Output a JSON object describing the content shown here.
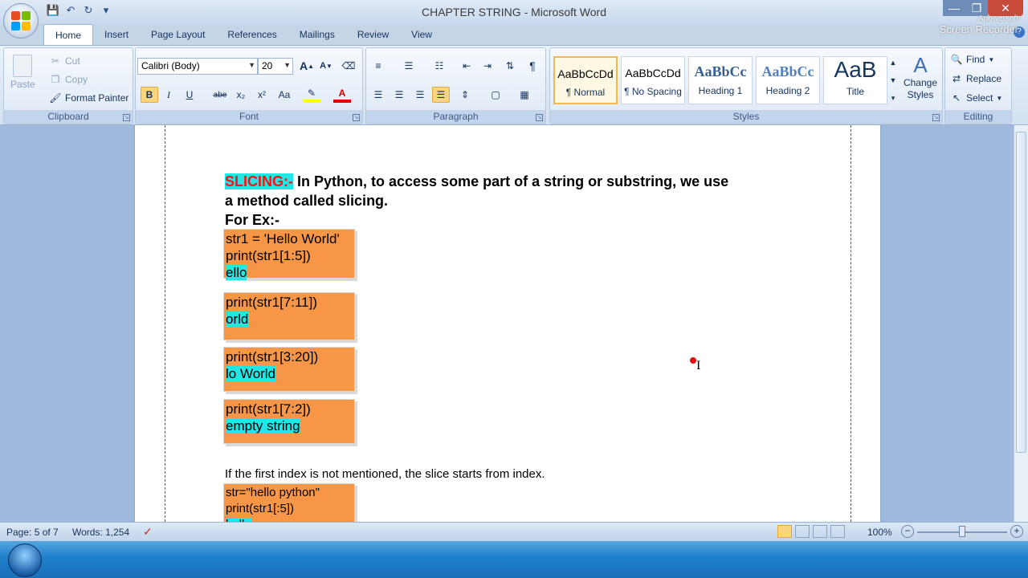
{
  "window": {
    "title": "CHAPTER STRING - Microsoft Word"
  },
  "quick_access": [
    "save-icon",
    "undo-icon",
    "redo-icon",
    "customize-icon"
  ],
  "tabs": [
    {
      "label": "Home",
      "active": true
    },
    {
      "label": "Insert"
    },
    {
      "label": "Page Layout"
    },
    {
      "label": "References"
    },
    {
      "label": "Mailings"
    },
    {
      "label": "Review"
    },
    {
      "label": "View"
    }
  ],
  "clipboard": {
    "paste": "Paste",
    "cut": "Cut",
    "copy": "Copy",
    "format_painter": "Format Painter",
    "label": "Clipboard"
  },
  "font": {
    "name": "Calibri (Body)",
    "size": "20",
    "label": "Font",
    "bold": "B",
    "italic": "I",
    "underline": "U",
    "strike": "abe",
    "subscript": "x₂",
    "superscript": "x²",
    "case": "Aa",
    "grow": "A",
    "shrink": "A",
    "font_color": "A"
  },
  "paragraph": {
    "label": "Paragraph",
    "pilcrow": "¶"
  },
  "styles": {
    "label": "Styles",
    "items": [
      {
        "sample": "AaBbCcDd",
        "name": "¶ Normal",
        "selected": true
      },
      {
        "sample": "AaBbCcDd",
        "name": "¶ No Spacing"
      },
      {
        "sample": "AaBbCc",
        "name": "Heading 1"
      },
      {
        "sample": "AaBbCc",
        "name": "Heading 2"
      },
      {
        "sample": "AaB",
        "name": "Title"
      }
    ],
    "change_styles": "Change Styles"
  },
  "editing": {
    "label": "Editing",
    "find": "Find",
    "replace": "Replace",
    "select": "Select"
  },
  "document": {
    "slicing_label": "SLICING:-",
    "slicing_text_1": " In Python, to access some part of a string or substring, we use",
    "slicing_text_2": "a method called slicing.",
    "for_ex": "For Ex:-",
    "box1": {
      "line1": "str1 = 'Hello World'",
      "line2": "print(str1[1:5])",
      "output": "ello"
    },
    "box2": {
      "line1": "print(str1[7:11])",
      "output": "orld"
    },
    "box3": {
      "line1": "print(str1[3:20])",
      "output": "lo World"
    },
    "box4": {
      "line1": "print(str1[7:2])",
      "output": "empty string"
    },
    "note": "If the first index is not mentioned, the slice starts from index.",
    "box5": {
      "line1": "str=\"hello python\"",
      "line2": "print(str1[:5])",
      "output": "hello"
    }
  },
  "status": {
    "page": "Page: 5 of 7",
    "words": "Words: 1,254",
    "zoom": "100%"
  },
  "watermark": {
    "line1": "Apowersoft",
    "line2": "Screen Recorder"
  }
}
